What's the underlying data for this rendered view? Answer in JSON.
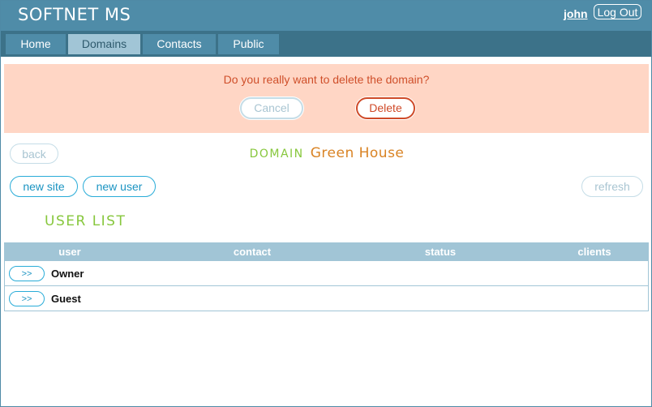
{
  "header": {
    "app_title": "SOFTNET MS",
    "username": "john",
    "logout_label": "Log Out"
  },
  "nav": {
    "tabs": [
      {
        "label": "Home",
        "active": false
      },
      {
        "label": "Domains",
        "active": true
      },
      {
        "label": "Contacts",
        "active": false
      },
      {
        "label": "Public",
        "active": false
      }
    ]
  },
  "confirm": {
    "message": "Do you really want to delete the domain?",
    "cancel_label": "Cancel",
    "delete_label": "Delete"
  },
  "domain": {
    "back_label": "back",
    "heading_label": "DOMAIN",
    "name": "Green House"
  },
  "actions": {
    "new_site_label": "new site",
    "new_user_label": "new user",
    "refresh_label": "refresh"
  },
  "user_list": {
    "title": "USER LIST",
    "columns": [
      "user",
      "contact",
      "status",
      "clients"
    ],
    "rows": [
      {
        "open_label": ">>",
        "user": "Owner",
        "contact": "",
        "status": "",
        "clients": ""
      },
      {
        "open_label": ">>",
        "user": "Guest",
        "contact": "",
        "status": "",
        "clients": ""
      }
    ]
  },
  "colors": {
    "header": "#4f8ca8",
    "nav": "#3c7289",
    "active_tab": "#a1c5d6",
    "confirm_bg": "#ffd6c5",
    "danger": "#cf4a28",
    "accent_green": "#87c73d",
    "accent_orange": "#d98324",
    "accent_blue": "#29acd8"
  }
}
